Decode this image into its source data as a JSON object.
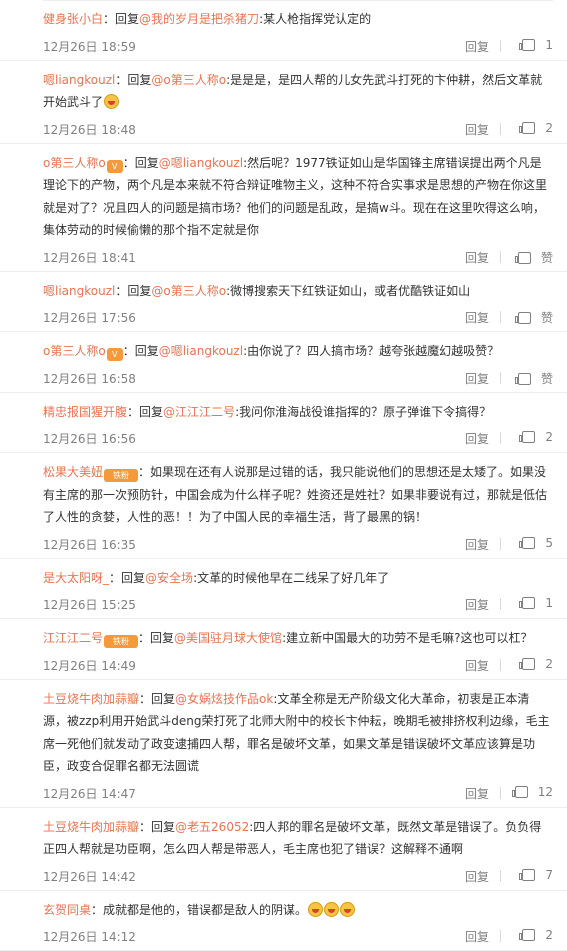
{
  "comments": [
    {
      "user": "健身张小白",
      "reply_word": "回复",
      "mention": "@我的岁月是把杀猪刀",
      "content": ":某人枪指挥党认定的",
      "time": "12月26日 18:59",
      "reply_label": "回复",
      "likes": "1",
      "badge": "",
      "emoji": false
    },
    {
      "user": "嗯liangkouzl",
      "reply_word": "回复",
      "mention": "@o第三人称o",
      "content": ":是是是，是四人帮的儿女先武斗打死的卞仲耕，然后文革就开始武斗了",
      "time": "12月26日 18:48",
      "reply_label": "回复",
      "likes": "2",
      "badge": "",
      "emoji": true
    },
    {
      "user": "o第三人称o",
      "reply_word": "回复",
      "mention": "@嗯liangkouzl",
      "content": ":然后呢？1977铁证如山是华国锋主席错误提出两个凡是理论下的产物，两个凡是本来就不符合辩证唯物主义，这种不符合实事求是思想的产物在你这里就是对了？况且四人的问题是搞市场？他们的问题是乱政，是搞w斗。现在在这里吹得这么响，集体劳动的时候偷懒的那个指不定就是你",
      "time": "12月26日 18:41",
      "reply_label": "回复",
      "likes": "赞",
      "badge": "V",
      "emoji": false
    },
    {
      "user": "嗯liangkouzl",
      "reply_word": "回复",
      "mention": "@o第三人称o",
      "content": ":微博搜索天下红铁证如山，或者优酷铁证如山",
      "time": "12月26日 17:56",
      "reply_label": "回复",
      "likes": "赞",
      "badge": "",
      "emoji": false
    },
    {
      "user": "o第三人称o",
      "reply_word": "回复",
      "mention": "@嗯liangkouzl",
      "content": ":由你说了？四人搞市场？越夸张越魔幻越吸赞？",
      "time": "12月26日 16:58",
      "reply_label": "回复",
      "likes": "赞",
      "badge": "V",
      "emoji": false
    },
    {
      "user": "精忠报国猩开腹",
      "reply_word": "回复",
      "mention": "@江江江二号",
      "content": ":我问你淮海战役谁指挥的？原子弹谁下令搞得？",
      "time": "12月26日 16:56",
      "reply_label": "回复",
      "likes": "2",
      "badge": "",
      "emoji": false
    },
    {
      "user": "松果大美妞",
      "reply_word": "",
      "mention": "",
      "content": "：如果现在还有人说那是过错的话，我只能说他们的思想还是太矮了。如果没有主席的那一次预防针，中国会成为什么样子呢？姓资还是姓社？如果非要说有过，那就是低估了人性的贪婪，人性的恶！！为了中国人民的幸福生活，背了最黑的锅！",
      "time": "12月26日 16:35",
      "reply_label": "回复",
      "likes": "5",
      "badge": "铁粉",
      "emoji": false
    },
    {
      "user": "是大太阳呀_",
      "reply_word": "回复",
      "mention": "@安全场",
      "content": ":文革的时候他早在二线呆了好几年了",
      "time": "12月26日 15:25",
      "reply_label": "回复",
      "likes": "1",
      "badge": "",
      "emoji": false
    },
    {
      "user": "江江江二号",
      "reply_word": "回复",
      "mention": "@美国驻月球大使馆",
      "content": ":建立新中国最大的功劳不是毛嘛?这也可以杠？",
      "time": "12月26日 14:49",
      "reply_label": "回复",
      "likes": "2",
      "badge": "铁粉",
      "emoji": false
    },
    {
      "user": "土豆烧牛肉加蒜瓣",
      "reply_word": "回复",
      "mention": "@女娲炫技作品ok",
      "content": ":文革全称是无产阶级文化大革命，初衷是正本清源，被zzp利用开始武斗deng荣打死了北师大附中的校长卞仲耘，晚期毛被排挤权利边缘，毛主席一死他们就发动了政变逮捕四人帮，罪名是破坏文革，如果文革是错误破坏文革应该算是功臣，政变合促罪名都无法圆谎",
      "time": "12月26日 14:47",
      "reply_label": "回复",
      "likes": "12",
      "badge": "",
      "emoji": false
    },
    {
      "user": "土豆烧牛肉加蒜瓣",
      "reply_word": "回复",
      "mention": "@老五26052",
      "content": ":四人邦的罪名是破坏文革，既然文革是错误了。负负得正四人帮就是功臣啊，怎么四人帮是带恶人，毛主席也犯了错误？这解释不通啊",
      "time": "12月26日 14:42",
      "reply_label": "回复",
      "likes": "7",
      "badge": "",
      "emoji": false
    },
    {
      "user": "玄贺同桌",
      "reply_word": "",
      "mention": "",
      "content": "：成就都是他的，错误都是敌人的阴谋。",
      "time": "12月26日 14:12",
      "reply_label": "回复",
      "likes": "2",
      "badge": "",
      "emoji": false,
      "emoji_count": 3
    }
  ]
}
